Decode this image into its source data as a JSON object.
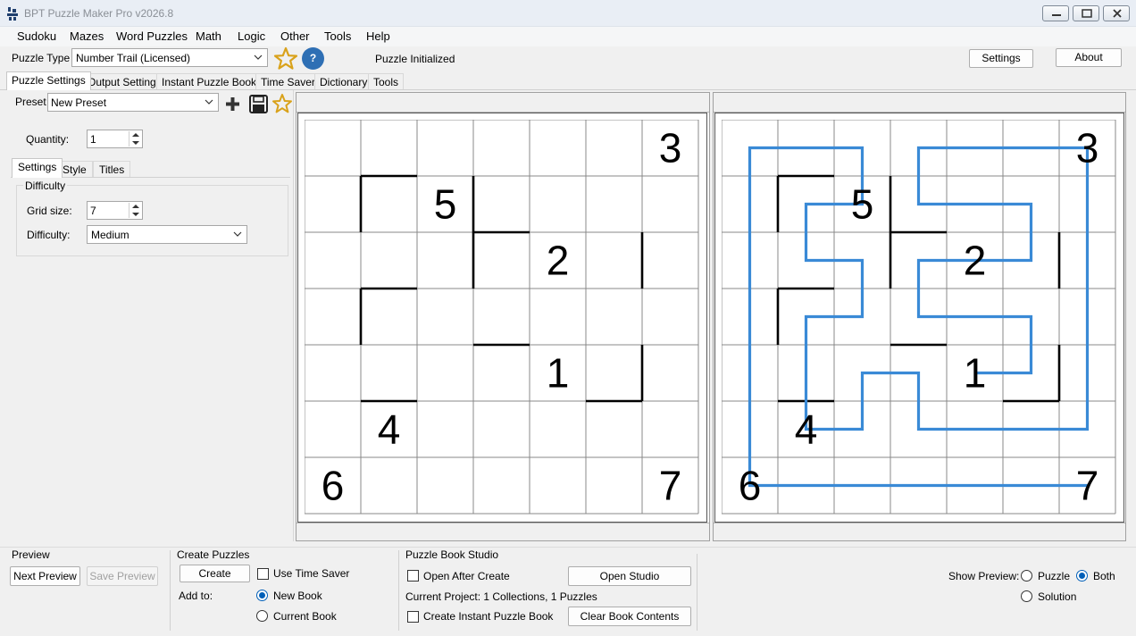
{
  "window": {
    "title": "BPT Puzzle Maker Pro v2026.8"
  },
  "menu": [
    "Sudoku",
    "Mazes",
    "Word Puzzles",
    "Math",
    "Logic",
    "Other",
    "Tools",
    "Help"
  ],
  "toolbar": {
    "puzzle_type_label": "Puzzle Type",
    "puzzle_type_value": "Number Trail (Licensed)",
    "help_glyph": "?",
    "status": "Puzzle Initialized",
    "settings_label": "Settings",
    "about_label": "About"
  },
  "tabs": [
    "Puzzle Settings",
    "Output Settings",
    "Instant Puzzle Books",
    "Time Saver",
    "Dictionary",
    "Tools"
  ],
  "left": {
    "preset_label": "Preset",
    "preset_value": "New Preset",
    "quantity_label": "Quantity:",
    "quantity_value": "1",
    "subtabs": [
      "Settings",
      "Style",
      "Titles"
    ],
    "group_title": "Difficulty",
    "grid_size_label": "Grid size:",
    "grid_size_value": "7",
    "difficulty_label": "Difficulty:",
    "difficulty_value": "Medium"
  },
  "puzzle": {
    "size": 7,
    "numbers": [
      {
        "row": 0,
        "col": 6,
        "value": "3"
      },
      {
        "row": 1,
        "col": 2,
        "value": "5"
      },
      {
        "row": 2,
        "col": 4,
        "value": "2"
      },
      {
        "row": 4,
        "col": 4,
        "value": "1"
      },
      {
        "row": 5,
        "col": 1,
        "value": "4"
      },
      {
        "row": 6,
        "col": 0,
        "value": "6"
      },
      {
        "row": 6,
        "col": 6,
        "value": "7"
      }
    ]
  },
  "bottom": {
    "preview_title": "Preview",
    "next_preview": "Next Preview",
    "save_preview": "Save Preview",
    "create_title": "Create Puzzles",
    "create_btn": "Create",
    "use_time_saver": "Use Time Saver",
    "add_to": "Add to:",
    "new_book": "New Book",
    "current_book": "Current Book",
    "studio_title": "Puzzle Book Studio",
    "open_after_create": "Open After Create",
    "open_studio": "Open Studio",
    "current_project": "Current Project: 1 Collections, 1 Puzzles",
    "create_instant_book": "Create Instant Puzzle Book",
    "clear_book": "Clear Book Contents",
    "show_preview_label": "Show Preview:",
    "opt_puzzle": "Puzzle",
    "opt_both": "Both",
    "opt_solution": "Solution"
  },
  "colors": {
    "accent": "#005fb8",
    "solution_path": "#3a8ad6",
    "help_icon": "#2e6fb4",
    "star": "#d9a21b"
  }
}
